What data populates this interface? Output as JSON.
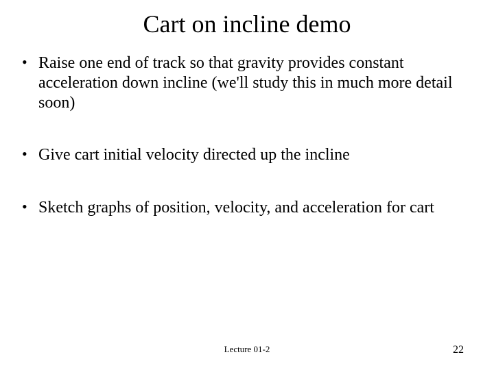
{
  "title": "Cart on incline demo",
  "bullets": [
    "Raise one end of track so that gravity provides constant acceleration down incline (we'll study this in much more detail soon)",
    "Give cart initial velocity directed up the incline",
    "Sketch graphs of position, velocity, and acceleration for cart"
  ],
  "footer": {
    "lecture": "Lecture 01-2",
    "page": "22"
  }
}
